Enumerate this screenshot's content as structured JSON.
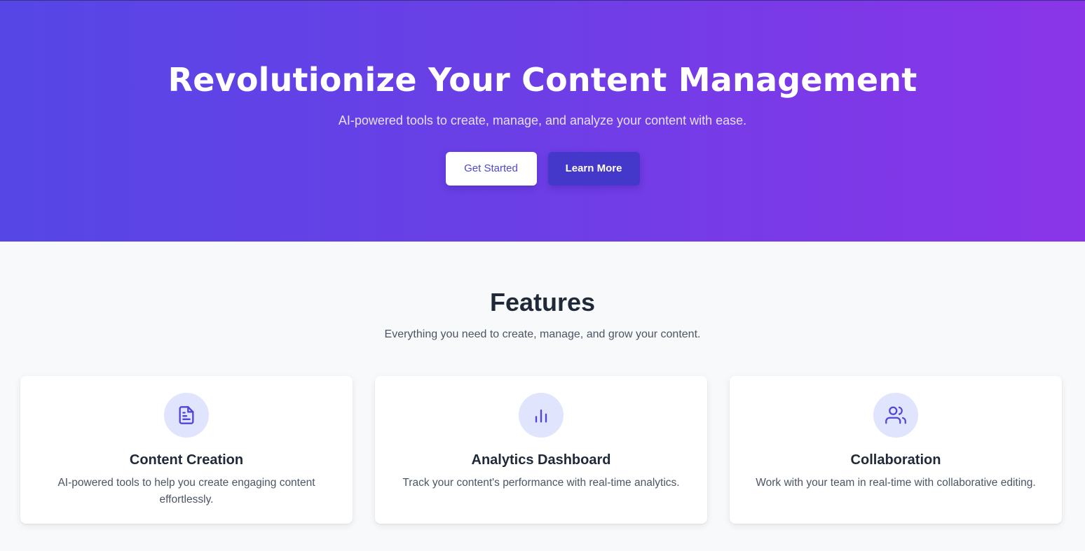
{
  "hero": {
    "title": "Revolutionize Your Content Management",
    "subtitle": "AI-powered tools to create, manage, and analyze your content with ease.",
    "primary_button": "Get Started",
    "secondary_button": "Learn More"
  },
  "features": {
    "title": "Features",
    "subtitle": "Everything you need to create, manage, and grow your content.",
    "items": [
      {
        "icon": "document-icon",
        "title": "Content Creation",
        "description": "AI-powered tools to help you create engaging content effortlessly."
      },
      {
        "icon": "bar-chart-icon",
        "title": "Analytics Dashboard",
        "description": "Track your content's performance with real-time analytics."
      },
      {
        "icon": "users-icon",
        "title": "Collaboration",
        "description": "Work with your team in real-time with collaborative editing."
      }
    ]
  },
  "colors": {
    "gradient_start": "#5646e6",
    "gradient_end": "#8a35e8",
    "accent": "#4f46d8",
    "icon_bg": "#e0e4fd"
  }
}
